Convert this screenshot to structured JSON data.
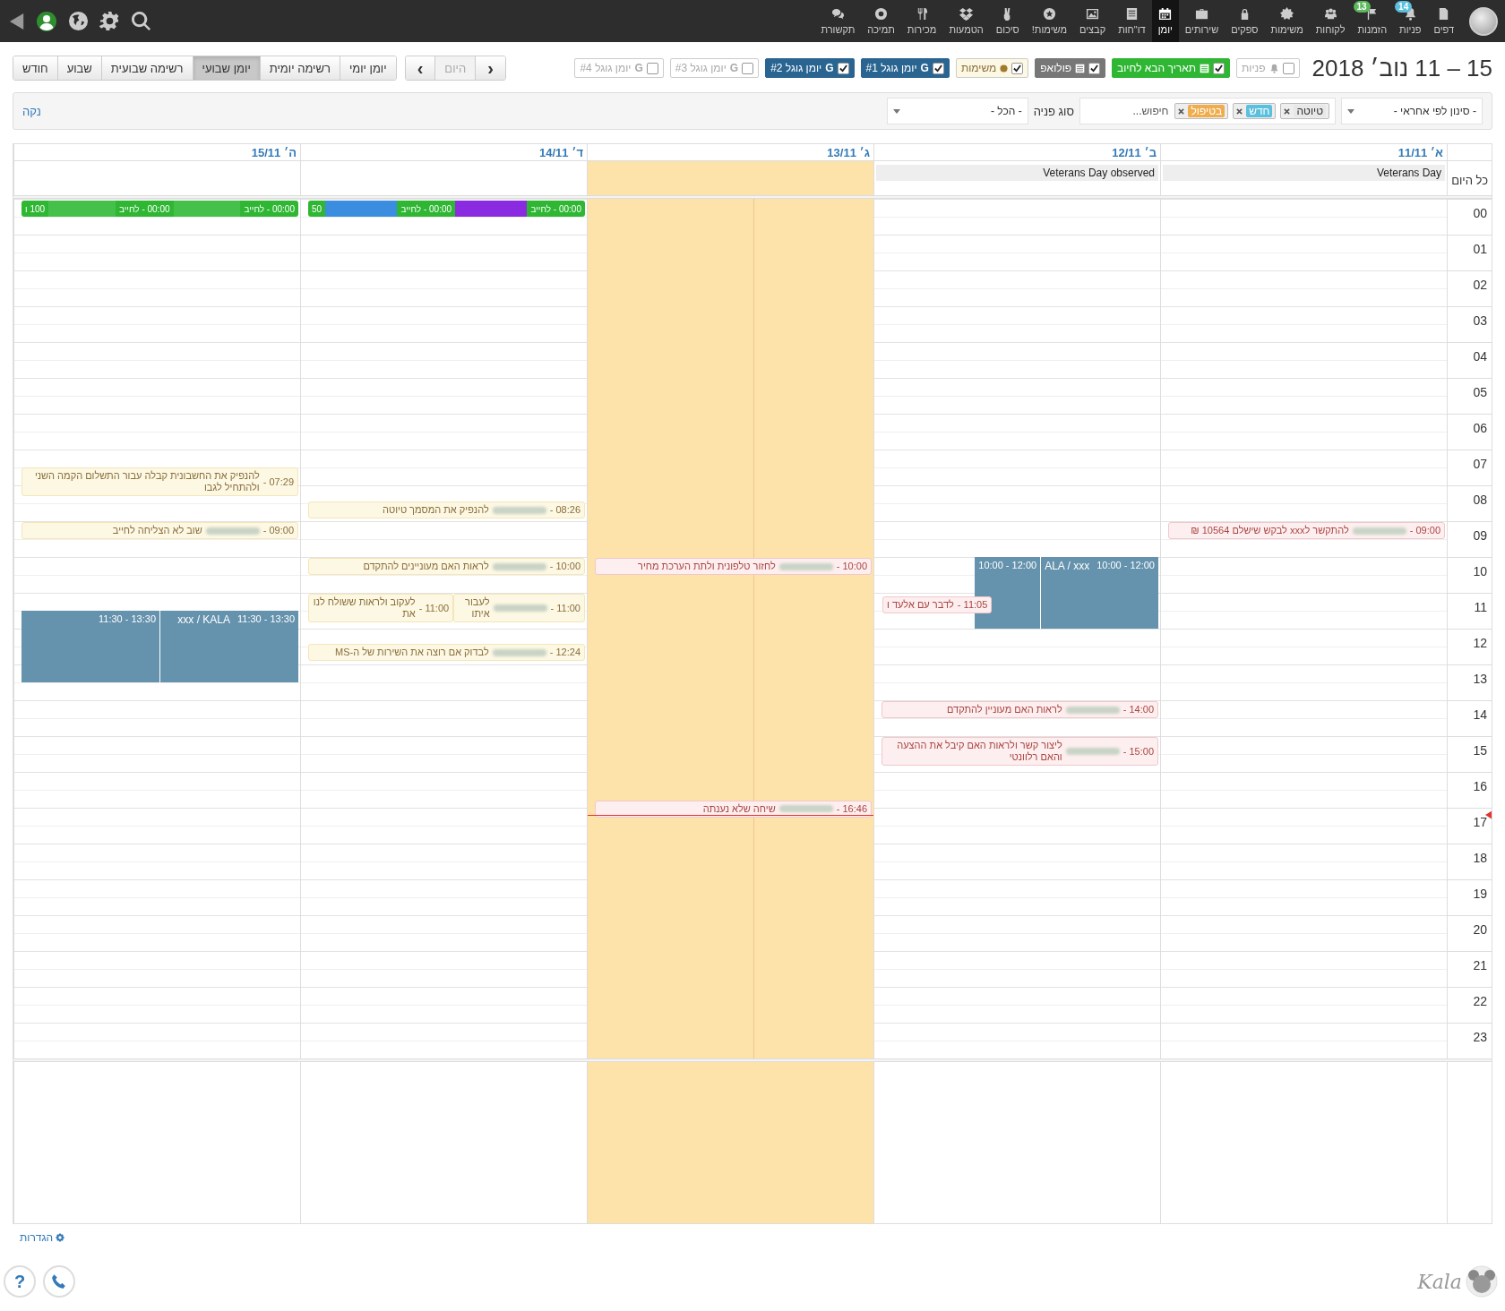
{
  "topbar": {
    "nav": [
      {
        "label": "דפים",
        "selected": false
      },
      {
        "label": "פניות",
        "selected": false,
        "badge": {
          "text": "14",
          "color": "#5bc0de"
        }
      },
      {
        "label": "הזמנות",
        "selected": false,
        "badge": {
          "text": "13",
          "color": "#5cb85c"
        }
      },
      {
        "label": "לקוחות",
        "selected": false
      },
      {
        "label": "משימות",
        "selected": false
      },
      {
        "label": "ספקים",
        "selected": false
      },
      {
        "label": "שירותים",
        "selected": false
      },
      {
        "label": "יומן",
        "selected": true
      },
      {
        "label": "דו\"חות",
        "selected": false
      },
      {
        "label": "קבצים",
        "selected": false
      },
      {
        "label": "משימות!",
        "selected": false
      },
      {
        "label": "סיכום",
        "selected": false
      },
      {
        "label": "הטמעות",
        "selected": false
      },
      {
        "label": "מכירות",
        "selected": false
      },
      {
        "label": "תמיכה",
        "selected": false
      },
      {
        "label": "תקשורת",
        "selected": false
      }
    ]
  },
  "toolbar": {
    "title": "15 – 11 נוב׳ 2018",
    "calendars": [
      {
        "kind": "bell",
        "label": "פניות",
        "checked": false,
        "color": "#ffffff"
      },
      {
        "kind": "list",
        "label": "תאריך הבא לחיוב",
        "checked": true,
        "color": "#2fb734"
      },
      {
        "kind": "list",
        "label": "פולואפ",
        "checked": true,
        "color": "#777777"
      },
      {
        "kind": "dot",
        "label": "משימות",
        "checked": true,
        "color": "#fcf8e3"
      },
      {
        "kind": "google",
        "glyph": "G",
        "label": "יומן גוגל #1",
        "checked": true,
        "color": "#2a6592"
      },
      {
        "kind": "google",
        "glyph": "G",
        "label": "יומן גוגל #2",
        "checked": true,
        "color": "#2a6592"
      },
      {
        "kind": "google",
        "glyph": "G",
        "label": "יומן גוגל #3",
        "checked": false,
        "color": "#ffffff"
      },
      {
        "kind": "google",
        "glyph": "G",
        "label": "יומן גוגל #4",
        "checked": false,
        "color": "#ffffff"
      }
    ],
    "nav_buttons": [
      {
        "label": "‹",
        "disabled": false
      },
      {
        "label": "היום",
        "disabled": true
      },
      {
        "label": "›",
        "disabled": false
      }
    ],
    "views": [
      {
        "label": "יומן יומי",
        "selected": false
      },
      {
        "label": "רשימה יומית",
        "selected": false
      },
      {
        "label": "יומן שבועי",
        "selected": true
      },
      {
        "label": "רשימה שבועית",
        "selected": false
      },
      {
        "label": "שבוע",
        "selected": false
      },
      {
        "label": "חודש",
        "selected": false
      }
    ]
  },
  "filters": {
    "owner_select": "- סינון לפי אחראי -",
    "tags": [
      {
        "label": "טיוטה",
        "color": "#e8e8e8"
      },
      {
        "label": "חדש",
        "color": "#5bc0de"
      },
      {
        "label": "בטיפול",
        "color": "#f0ad4e"
      }
    ],
    "search_placeholder": "חיפוש...",
    "type_label": "סוג פניה",
    "type_select": "- הכל -",
    "clear_link": "נקה"
  },
  "calendar": {
    "allday_label": "כל היום",
    "hours": [
      "00",
      "01",
      "02",
      "03",
      "04",
      "05",
      "06",
      "07",
      "08",
      "09",
      "10",
      "11",
      "12",
      "13",
      "14",
      "15",
      "16",
      "17",
      "18",
      "19",
      "20",
      "21",
      "22",
      "23"
    ],
    "days": [
      {
        "label": "א׳ 11/11",
        "today": false,
        "allday": [
          "Veterans Day"
        ],
        "events": [
          {
            "kind": "lead",
            "time": "09:00 -",
            "redacted": true,
            "title": "להתקשר לxxx לבקש שישלם 10564 ₪"
          }
        ]
      },
      {
        "label": "ב׳ 12/11",
        "today": false,
        "allday": [
          "Veterans Day observed"
        ],
        "events": [
          {
            "kind": "meeting",
            "parts": [
              {
                "time": "10:00 - 12:00",
                "title": "ALA / xxx"
              },
              {
                "time": "10:00 - 12:00"
              }
            ]
          },
          {
            "kind": "popout",
            "time": "11:05 -",
            "redacted": false,
            "title": "לדבר עם אלעד ו"
          },
          {
            "kind": "lead",
            "time": "14:00 -",
            "redacted": true,
            "title": "לראות האם מעוניין להתקדם"
          },
          {
            "kind": "lead",
            "time": "15:00 -",
            "redacted": true,
            "title": "ליצור קשר ולראות האם קיבל את ההצעה והאם רלוונטי"
          }
        ]
      },
      {
        "label": "ג׳ 13/11",
        "today": true,
        "now_line": true,
        "events": [
          {
            "kind": "lead",
            "time": "10:00 -",
            "redacted": true,
            "title": "לחזור טלפונית ולתת הערכת מחיר"
          },
          {
            "kind": "lead",
            "time": "16:46 -",
            "redacted": true,
            "title": "שיחה שלא נענתה"
          }
        ]
      },
      {
        "label": "ד׳ 14/11",
        "today": false,
        "events": [
          {
            "kind": "strip",
            "segments": [
              {
                "kind": "text",
                "text": "00:00 - לחייב",
                "color": "#2fb734"
              },
              {
                "kind": "redacted",
                "color": "#8a2be2"
              },
              {
                "kind": "text",
                "text": "00:00 - לחייב",
                "color": "#2fb734"
              },
              {
                "kind": "redacted",
                "color": "#3b8de0"
              },
              {
                "kind": "text",
                "text": "50",
                "color": "#2fb734"
              }
            ]
          },
          {
            "kind": "task",
            "time": "08:26 -",
            "redacted": true,
            "title": "להנפיק את המסמך טיוטה"
          },
          {
            "kind": "task",
            "time": "10:00 -",
            "redacted": true,
            "title": "לראות האם מעוניינים להתקדם"
          },
          {
            "kind": "split",
            "parts": [
              {
                "time": "11:00 -",
                "redacted": true,
                "title": "לעבור איתו"
              },
              {
                "time": "11:00 -",
                "redacted": false,
                "title": "לעקוב ולראות ששולח לנו את"
              }
            ]
          },
          {
            "kind": "task",
            "time": "12:24 -",
            "redacted": true,
            "title": "לבדוק אם רוצה את השירות של ה-MS"
          }
        ]
      },
      {
        "label": "ה׳ 15/11",
        "today": false,
        "events": [
          {
            "kind": "strip",
            "segments": [
              {
                "kind": "text",
                "text": "00:00 - לחייב",
                "color": "#2fb734"
              },
              {
                "kind": "redacted",
                "color": "#45c04a"
              },
              {
                "kind": "text",
                "text": "00:00 - לחייב",
                "color": "#2fb734"
              },
              {
                "kind": "redacted",
                "color": "#45c04a"
              },
              {
                "kind": "text",
                "text": "100 ו",
                "color": "#2fb734"
              }
            ]
          },
          {
            "kind": "task",
            "time": "07:29 -",
            "redacted": false,
            "title": "להנפיק את החשבונית קבלה עבור התשלום הקמה השני ולהתחיל לגבו"
          },
          {
            "kind": "task",
            "time": "09:00 -",
            "redacted": true,
            "title": "שוב לא הצליחה לחייב"
          },
          {
            "kind": "meeting",
            "parts": [
              {
                "time": "11:30 - 13:30",
                "title": "xxx / KALA"
              },
              {
                "time": "11:30 - 13:30"
              }
            ]
          }
        ]
      }
    ]
  },
  "footer": {
    "settings_link": "הגדרות",
    "help": "?",
    "logo": "Kala"
  }
}
